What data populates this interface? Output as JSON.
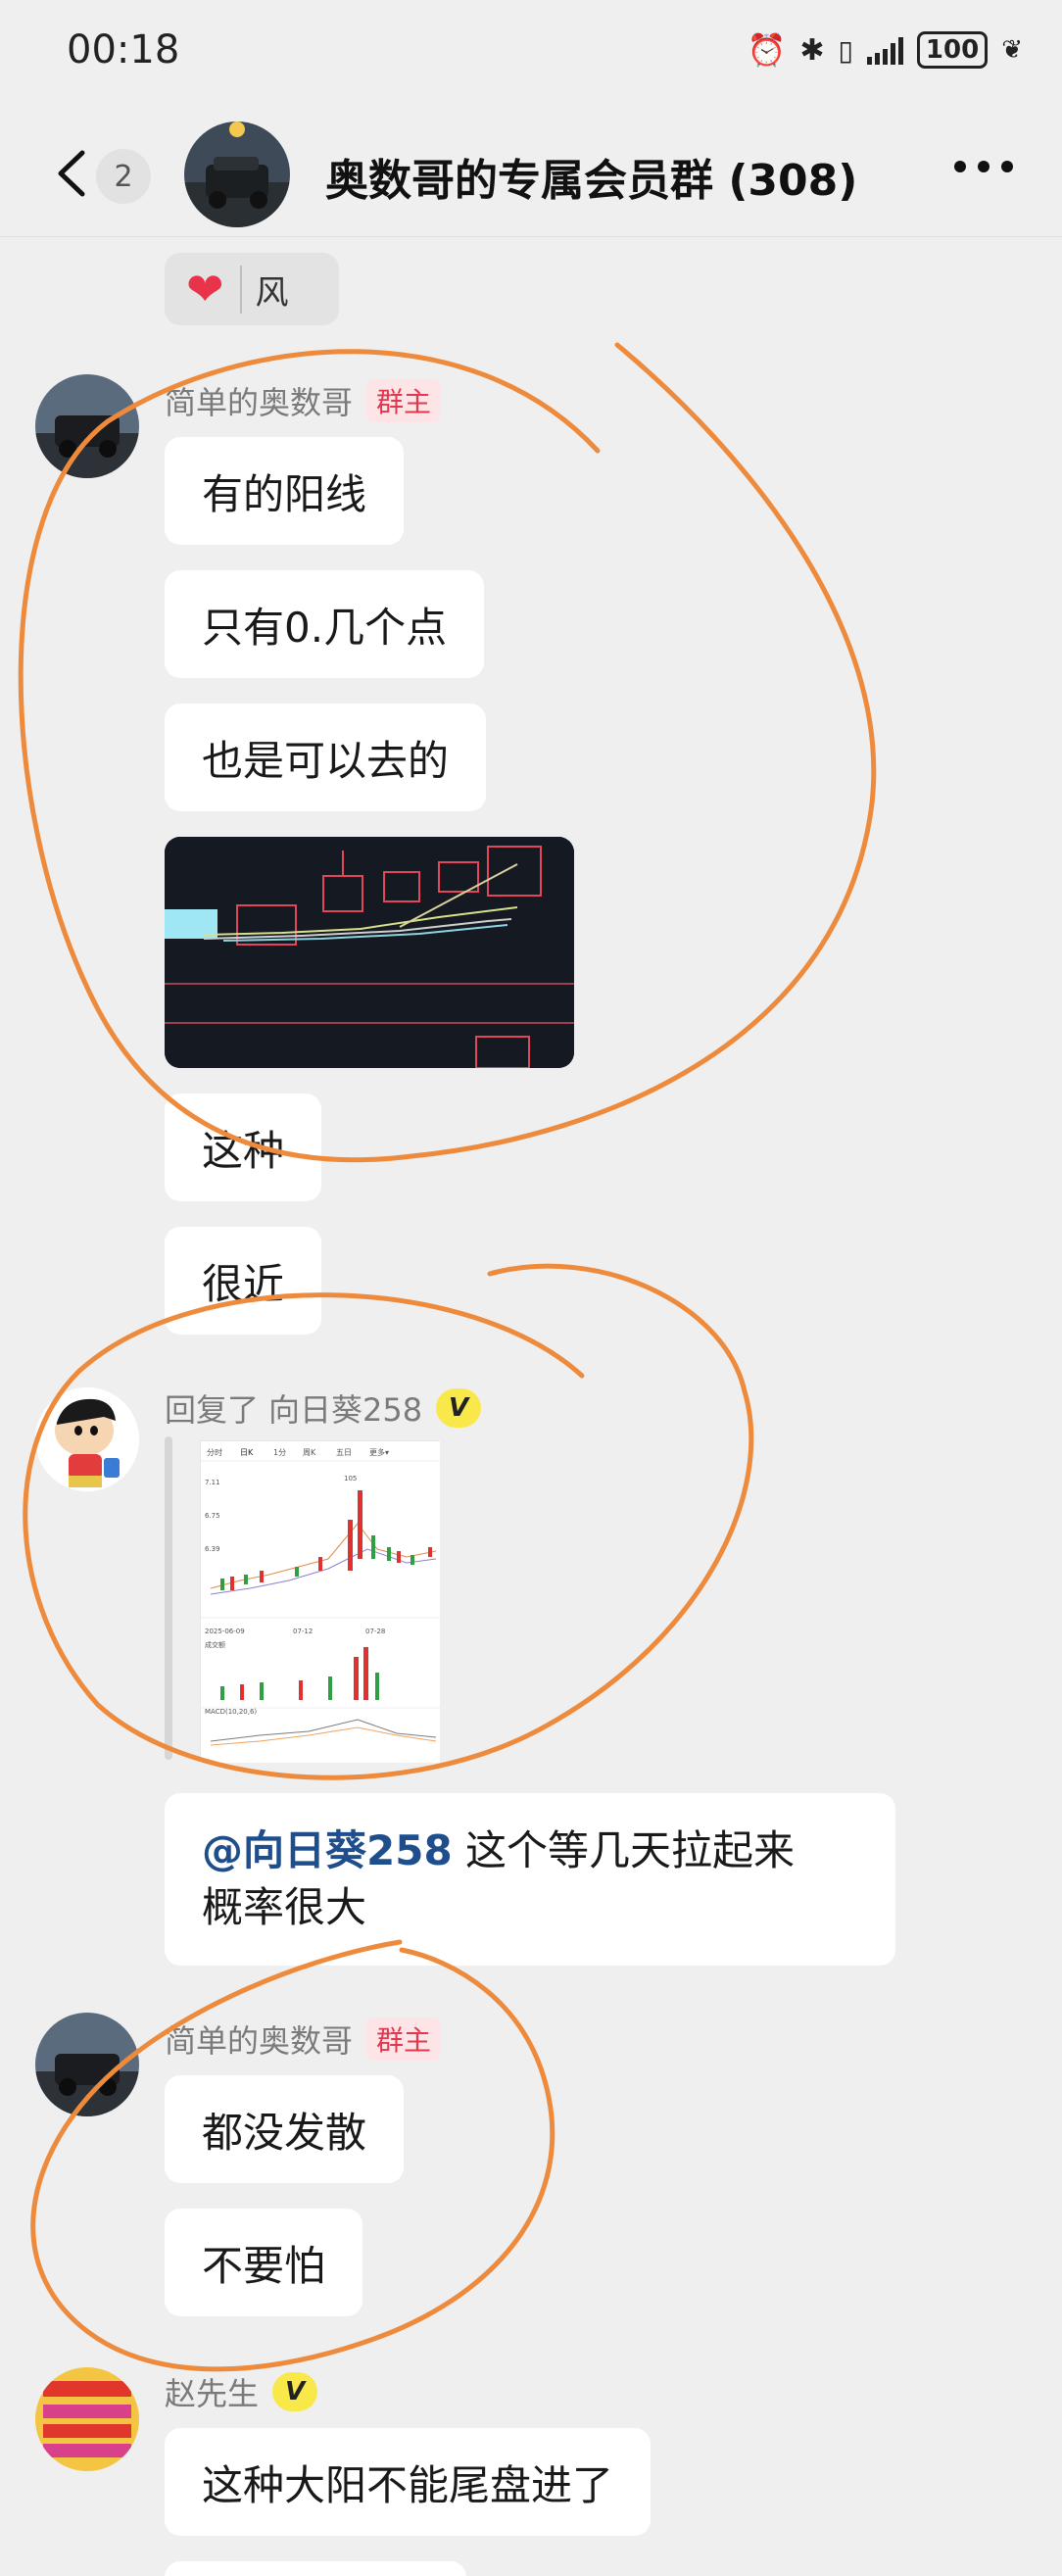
{
  "status_bar": {
    "time": "00:18",
    "battery": "100",
    "icons": [
      "alarm-icon",
      "bluetooth-icon",
      "vibrate-icon",
      "signal-icon",
      "battery-icon",
      "leaf-icon"
    ]
  },
  "header": {
    "back_icon": "chevron-left-icon",
    "unread_count": "2",
    "title": "奥数哥的专属会员群 (308)",
    "more_icon": "more-dots-icon"
  },
  "reaction": {
    "emoji": "❤",
    "name": "风"
  },
  "messages": [
    {
      "sender": "简单的奥数哥",
      "role": "群主",
      "bubbles": [
        "有的阳线",
        "只有0.几个点",
        "也是可以去的",
        "这种",
        "很近"
      ],
      "image": "candlestick-chart-photo"
    },
    {
      "sender_prefix": "回复了",
      "sender": "向日葵258",
      "badge": "V",
      "quoted_image": {
        "tabs": [
          "分时",
          "日K",
          "1分",
          "周K",
          "五日",
          "更多▾"
        ],
        "labels": [
          "成交额",
          "MACD(10,20,6)",
          "7.11",
          "6.75",
          "6.39",
          "2025-06-09",
          "07-12",
          "07-28",
          "105"
        ]
      }
    },
    {
      "mention": "@向日葵258",
      "text_line1": " 这个等几天拉起来",
      "text_line2": "概率很大"
    },
    {
      "sender": "简单的奥数哥",
      "role": "群主",
      "bubbles": [
        "都没发散",
        "不要怕"
      ]
    },
    {
      "sender": "赵先生",
      "badge": "V",
      "bubbles": [
        "这种大阳不能尾盘进了"
      ]
    }
  ],
  "colors": {
    "background": "#efefef",
    "bubble": "#ffffff",
    "role_tag": "#e0384e",
    "mention": "#1f4e8c",
    "annotation": "#ee8a3c",
    "vip": "#f9e84a"
  }
}
